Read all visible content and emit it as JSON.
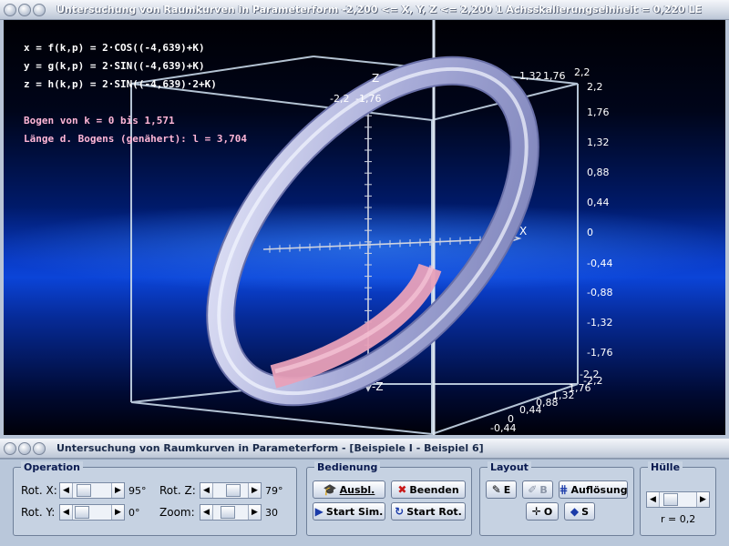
{
  "window_top": {
    "title": "Untersuchung von Raumkurven in Parameterform    -2,200 <= X, Y, Z <= 2,200    1 Achsskalierungseinheit = 0,220 LE"
  },
  "canvas": {
    "formulas": [
      "x = f(k,p) = 2·COS((-4,639)+K)",
      "y = g(k,p) = 2·SIN((-4,639)+K)",
      "z = h(k,p) = 2·SIN((-4,639)·2+K)"
    ],
    "arc_text": "Bogen von k = 0 bis 1,571",
    "length_text": "Länge d. Bogens (genähert): l = 3,704",
    "axis_labels": {
      "z": "Z",
      "neg_z": "-Z",
      "x": "X"
    },
    "right_ticks": [
      "2,2",
      "1,76",
      "1,32",
      "0,88",
      "0,44",
      "0",
      "-0,44",
      "-0,88",
      "-1,32",
      "-1,76",
      "-2,2"
    ],
    "bottom_ticks": [
      "-2,2",
      "1,76",
      "1,32",
      "0,88",
      "0,44",
      "0",
      "-0,44"
    ],
    "top_ticks": [
      "-2,2",
      "-1,76",
      "1,32",
      "1,76",
      "2,2"
    ],
    "colors": {
      "ring": "#b4b8e8",
      "arc": "#e8a0b8",
      "frame": "#c8d8e8"
    }
  },
  "window_bottom": {
    "title": "Untersuchung von Raumkurven in Parameterform - [Beispiele I - Beispiel 6]"
  },
  "operation": {
    "title": "Operation",
    "rot_x_label": "Rot. X:",
    "rot_x_value": "95°",
    "rot_y_label": "Rot. Y:",
    "rot_y_value": "0°",
    "rot_z_label": "Rot. Z:",
    "rot_z_value": "79°",
    "zoom_label": "Zoom:",
    "zoom_value": "30"
  },
  "bedienung": {
    "title": "Bedienung",
    "ausbl": "Ausbl.",
    "beenden": "Beenden",
    "start_sim": "Start Sim.",
    "start_rot": "Start Rot."
  },
  "layout": {
    "title": "Layout",
    "e": "E",
    "b": "B",
    "aufloesung": "Auflösung",
    "o": "O",
    "s": "S"
  },
  "huelle": {
    "title": "Hülle",
    "r_value": "r = 0,2"
  }
}
